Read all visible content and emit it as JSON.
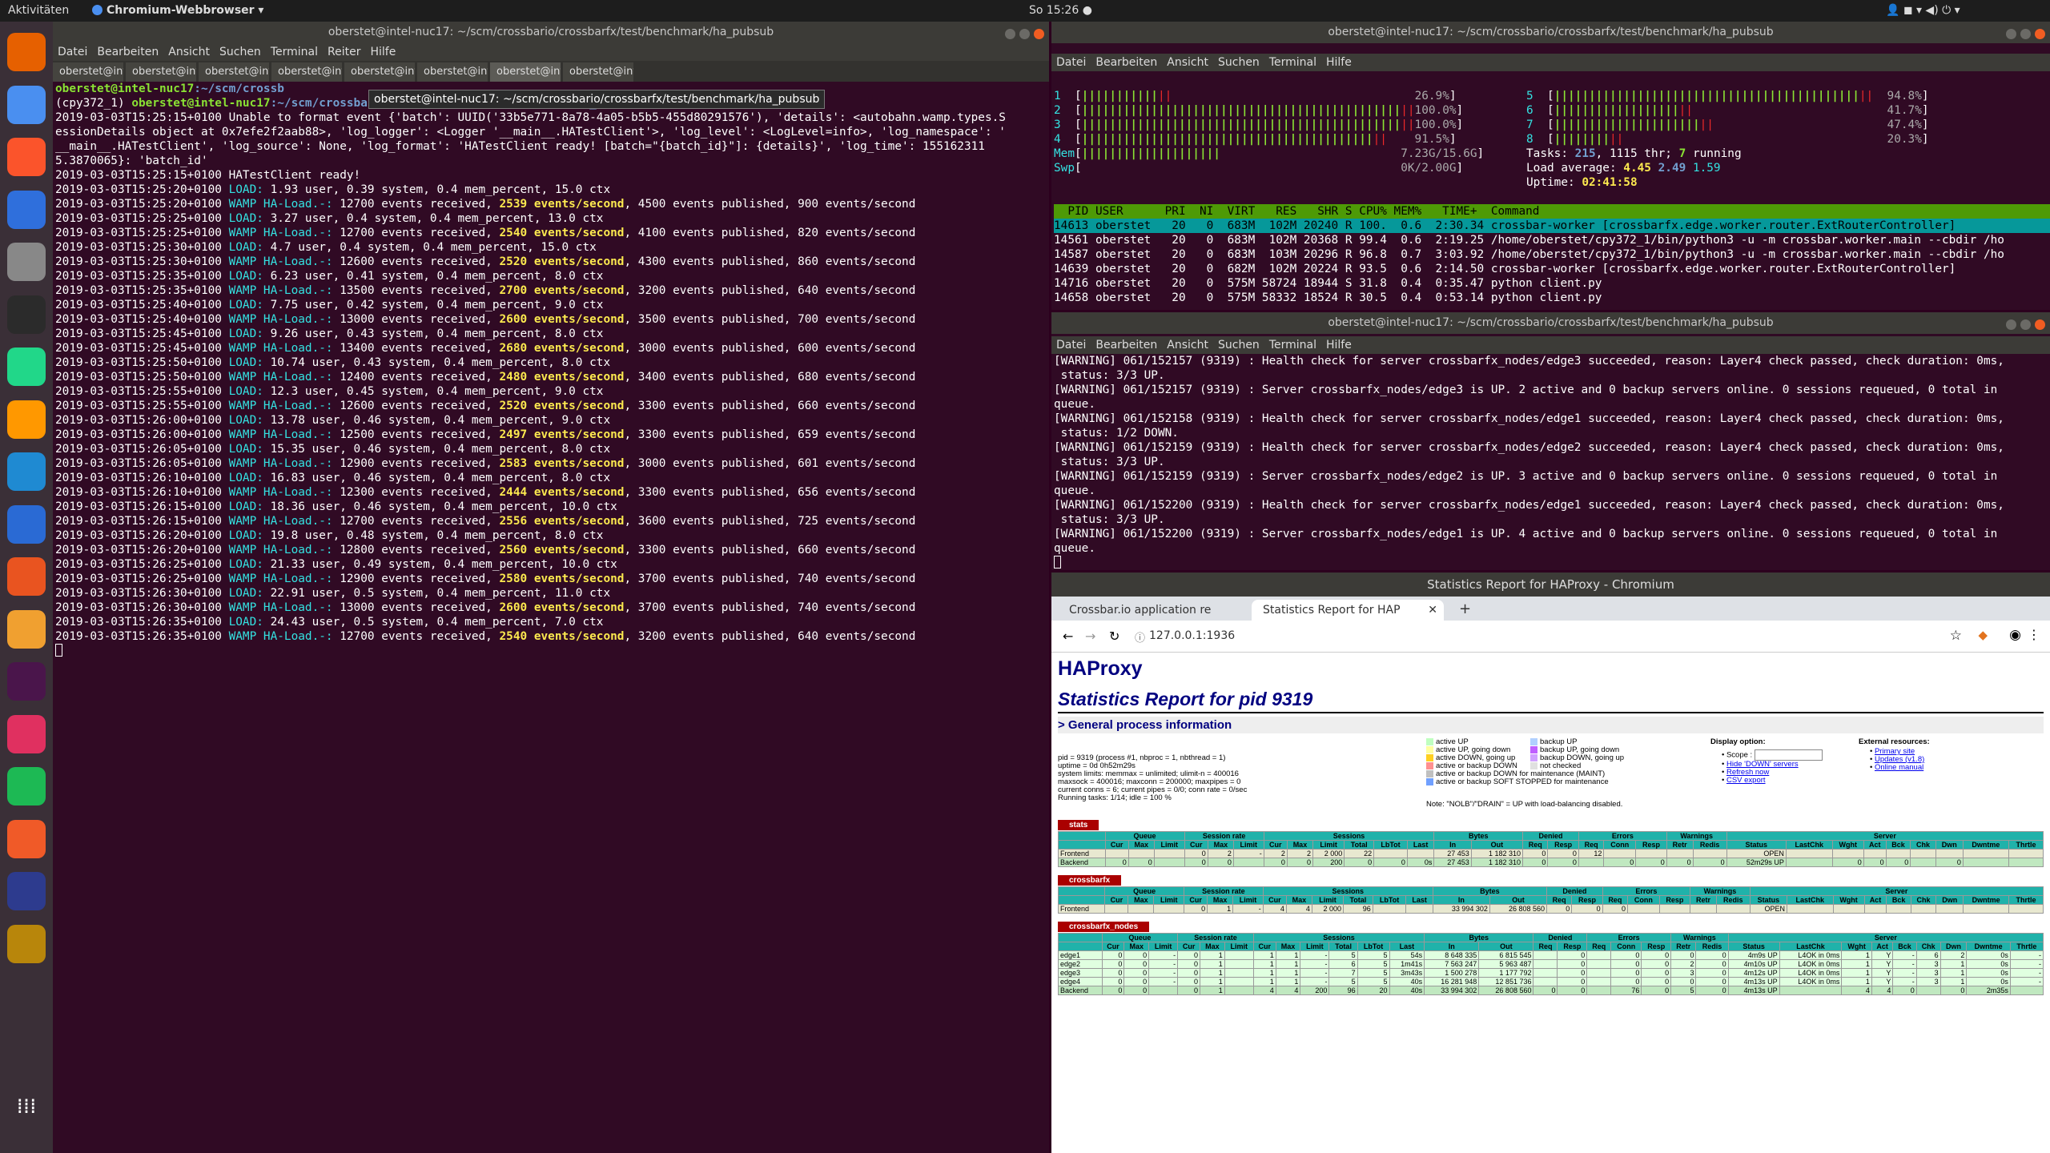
{
  "topbar": {
    "activities": "Aktivitäten",
    "app": "Chromium-Webbrowser ▾",
    "clock": "So 15:26 ●"
  },
  "dock": {
    "icons": [
      "firefox-icon",
      "chromium-icon",
      "brave-icon",
      "thunderbird-icon",
      "files-icon",
      "terminal-icon",
      "pycharm-icon",
      "sublime-icon",
      "vscode-icon",
      "writer-icon",
      "software-icon",
      "game-icon",
      "slack-icon",
      "mail-icon",
      "spotify-icon",
      "crossover-icon",
      "vlc-icon",
      "image-viewer-icon",
      "apps-grid-icon"
    ]
  },
  "left": {
    "title": "oberstet@intel-nuc17: ~/scm/crossbario/crossbarfx/test/benchmark/ha_pubsub",
    "menu": [
      "Datei",
      "Bearbeiten",
      "Ansicht",
      "Suchen",
      "Terminal",
      "Reiter",
      "Hilfe"
    ],
    "tabs": [
      "oberstet@int...",
      "oberstet@int...",
      "oberstet@int...",
      "oberstet@int...",
      "oberstet@int...",
      "oberstet@int...",
      "oberstet@int...",
      "oberstet@int..."
    ],
    "tooltip": "oberstet@intel-nuc17: ~/scm/crossbario/crossbarfx/test/benchmark/ha_pubsub",
    "prompt_user": "oberstet@intel-nuc17",
    "prompt_path1": ":~/scm/crossb",
    "prompt_path2": ":~/scm/crossbario/crossbarfx/test/benchmark/ha_pubsub",
    "cmd": "$ python client.py",
    "env": "(cpy372_1) ",
    "raw": [
      "essionDetails object at 0x7efe2f2aab88>, 'log_logger': <Logger '__main__.HATestClient'>, 'log_level': <LogLevel=info>, 'log_namespace': '",
      "__main__.HATestClient', 'log_source': None, 'log_format': 'HATestClient ready! [batch=\"{batch_id}\"]: {details}', 'log_time': 155162311",
      "5.3870065}: 'batch_id'",
      "2019-03-03T15:25:15+0100 HATestClient ready!"
    ],
    "unable": "2019-03-03T15:25:15+0100 Unable to format event {'batch': UUID('33b5e771-8a78-4a05-b5b5-455d80291576'), 'details': <autobahn.wamp.types.S",
    "logs": [
      {
        "ts": "2019-03-03T15:25:20+0100",
        "k": "L",
        "t": "1.93 user, 0.39 system, 0.4 mem_percent, 15.0 ctx"
      },
      {
        "ts": "2019-03-03T15:25:20+0100",
        "k": "W",
        "a": "12700 events received, ",
        "e": "2539 events/second",
        "c": ", 4500 events published, 900 events/second"
      },
      {
        "ts": "2019-03-03T15:25:25+0100",
        "k": "L",
        "t": "3.27 user, 0.4 system, 0.4 mem_percent, 13.0 ctx"
      },
      {
        "ts": "2019-03-03T15:25:25+0100",
        "k": "W",
        "a": "12700 events received, ",
        "e": "2540 events/second",
        "c": ", 4100 events published, 820 events/second"
      },
      {
        "ts": "2019-03-03T15:25:30+0100",
        "k": "L",
        "t": "4.7 user, 0.4 system, 0.4 mem_percent, 15.0 ctx"
      },
      {
        "ts": "2019-03-03T15:25:30+0100",
        "k": "W",
        "a": "12600 events received, ",
        "e": "2520 events/second",
        "c": ", 4300 events published, 860 events/second"
      },
      {
        "ts": "2019-03-03T15:25:35+0100",
        "k": "L",
        "t": "6.23 user, 0.41 system, 0.4 mem_percent, 8.0 ctx"
      },
      {
        "ts": "2019-03-03T15:25:35+0100",
        "k": "W",
        "a": "13500 events received, ",
        "e": "2700 events/second",
        "c": ", 3200 events published, 640 events/second"
      },
      {
        "ts": "2019-03-03T15:25:40+0100",
        "k": "L",
        "t": "7.75 user, 0.42 system, 0.4 mem_percent, 9.0 ctx"
      },
      {
        "ts": "2019-03-03T15:25:40+0100",
        "k": "W",
        "a": "13000 events received, ",
        "e": "2600 events/second",
        "c": ", 3500 events published, 700 events/second"
      },
      {
        "ts": "2019-03-03T15:25:45+0100",
        "k": "L",
        "t": "9.26 user, 0.43 system, 0.4 mem_percent, 8.0 ctx"
      },
      {
        "ts": "2019-03-03T15:25:45+0100",
        "k": "W",
        "a": "13400 events received, ",
        "e": "2680 events/second",
        "c": ", 3000 events published, 600 events/second"
      },
      {
        "ts": "2019-03-03T15:25:50+0100",
        "k": "L",
        "t": "10.74 user, 0.43 system, 0.4 mem_percent, 8.0 ctx"
      },
      {
        "ts": "2019-03-03T15:25:50+0100",
        "k": "W",
        "a": "12400 events received, ",
        "e": "2480 events/second",
        "c": ", 3400 events published, 680 events/second"
      },
      {
        "ts": "2019-03-03T15:25:55+0100",
        "k": "L",
        "t": "12.3 user, 0.45 system, 0.4 mem_percent, 9.0 ctx"
      },
      {
        "ts": "2019-03-03T15:25:55+0100",
        "k": "W",
        "a": "12600 events received, ",
        "e": "2520 events/second",
        "c": ", 3300 events published, 660 events/second"
      },
      {
        "ts": "2019-03-03T15:26:00+0100",
        "k": "L",
        "t": "13.78 user, 0.46 system, 0.4 mem_percent, 9.0 ctx"
      },
      {
        "ts": "2019-03-03T15:26:00+0100",
        "k": "W",
        "a": "12500 events received, ",
        "e": "2497 events/second",
        "c": ", 3300 events published, 659 events/second"
      },
      {
        "ts": "2019-03-03T15:26:05+0100",
        "k": "L",
        "t": "15.35 user, 0.46 system, 0.4 mem_percent, 8.0 ctx"
      },
      {
        "ts": "2019-03-03T15:26:05+0100",
        "k": "W",
        "a": "12900 events received, ",
        "e": "2583 events/second",
        "c": ", 3000 events published, 601 events/second"
      },
      {
        "ts": "2019-03-03T15:26:10+0100",
        "k": "L",
        "t": "16.83 user, 0.46 system, 0.4 mem_percent, 8.0 ctx"
      },
      {
        "ts": "2019-03-03T15:26:10+0100",
        "k": "W",
        "a": "12300 events received, ",
        "e": "2444 events/second",
        "c": ", 3300 events published, 656 events/second"
      },
      {
        "ts": "2019-03-03T15:26:15+0100",
        "k": "L",
        "t": "18.36 user, 0.46 system, 0.4 mem_percent, 10.0 ctx"
      },
      {
        "ts": "2019-03-03T15:26:15+0100",
        "k": "W",
        "a": "12700 events received, ",
        "e": "2556 events/second",
        "c": ", 3600 events published, 725 events/second"
      },
      {
        "ts": "2019-03-03T15:26:20+0100",
        "k": "L",
        "t": "19.8 user, 0.48 system, 0.4 mem_percent, 8.0 ctx"
      },
      {
        "ts": "2019-03-03T15:26:20+0100",
        "k": "W",
        "a": "12800 events received, ",
        "e": "2560 events/second",
        "c": ", 3300 events published, 660 events/second"
      },
      {
        "ts": "2019-03-03T15:26:25+0100",
        "k": "L",
        "t": "21.33 user, 0.49 system, 0.4 mem_percent, 10.0 ctx"
      },
      {
        "ts": "2019-03-03T15:26:25+0100",
        "k": "W",
        "a": "12900 events received, ",
        "e": "2580 events/second",
        "c": ", 3700 events published, 740 events/second"
      },
      {
        "ts": "2019-03-03T15:26:30+0100",
        "k": "L",
        "t": "22.91 user, 0.5 system, 0.4 mem_percent, 11.0 ctx"
      },
      {
        "ts": "2019-03-03T15:26:30+0100",
        "k": "W",
        "a": "13000 events received, ",
        "e": "2600 events/second",
        "c": ", 3700 events published, 740 events/second"
      },
      {
        "ts": "2019-03-03T15:26:35+0100",
        "k": "L",
        "t": "24.43 user, 0.5 system, 0.4 mem_percent, 7.0 ctx"
      },
      {
        "ts": "2019-03-03T15:26:35+0100",
        "k": "W",
        "a": "12700 events received, ",
        "e": "2540 events/second",
        "c": ", 3200 events published, 640 events/second"
      }
    ],
    "load_label": "LOAD: ",
    "wamp_label": "WAMP HA-Load.-: "
  },
  "htop": {
    "title": "oberstet@intel-nuc17: ~/scm/crossbario/crossbarfx/test/benchmark/ha_pubsub",
    "menu": [
      "Datei",
      "Bearbeiten",
      "Ansicht",
      "Suchen",
      "Terminal",
      "Hilfe"
    ],
    "cpus_left": [
      {
        "n": "1",
        "p": "26.9%",
        "f": 0.27
      },
      {
        "n": "2",
        "p": "100.0%",
        "f": 1.0
      },
      {
        "n": "3",
        "p": "100.0%",
        "f": 1.0
      },
      {
        "n": "4",
        "p": "91.5%",
        "f": 0.92
      }
    ],
    "cpus_right": [
      {
        "n": "5",
        "p": "94.8%",
        "f": 0.95
      },
      {
        "n": "6",
        "p": "41.7%",
        "f": 0.42
      },
      {
        "n": "7",
        "p": "47.4%",
        "f": 0.47
      },
      {
        "n": "8",
        "p": "20.3%",
        "f": 0.2
      }
    ],
    "mem": "7.23G/15.6G",
    "swp": "0K/2.00G",
    "tasks": "Tasks: ",
    "tasks_n": "215",
    "thr": ", 1115 thr; ",
    "run_n": "7",
    "running": " running",
    "load": "Load average: ",
    "load1": "4.45",
    "load5": " 2.49",
    "load15": " 1.59",
    "uptime": "Uptime: ",
    "uptime_v": "02:41:58",
    "header": "  PID USER      PRI  NI  VIRT   RES   SHR S CPU% MEM%   TIME+  Command",
    "procs": [
      "14613 oberstet   20   0  683M  102M 20240 R 100.  0.6  2:30.34 crossbar-worker [crossbarfx.edge.worker.router.ExtRouterController]",
      "14561 oberstet   20   0  683M  102M 20368 R 99.4  0.6  2:19.25 /home/oberstet/cpy372_1/bin/python3 -u -m crossbar.worker.main --cbdir /ho",
      "14587 oberstet   20   0  683M  103M 20296 R 96.8  0.7  3:03.92 /home/oberstet/cpy372_1/bin/python3 -u -m crossbar.worker.main --cbdir /ho",
      "14639 oberstet   20   0  682M  102M 20224 R 93.5  0.6  2:14.50 crossbar-worker [crossbarfx.edge.worker.router.ExtRouterController]",
      "14716 oberstet   20   0  575M 58724 18944 S 31.8  0.4  0:35.47 python client.py",
      "14658 oberstet   20   0  575M 58332 18524 R 30.5  0.4  0:53.14 python client.py"
    ]
  },
  "haproxy_log": {
    "title": "oberstet@intel-nuc17: ~/scm/crossbario/crossbarfx/test/benchmark/ha_pubsub",
    "menu": [
      "Datei",
      "Bearbeiten",
      "Ansicht",
      "Suchen",
      "Terminal",
      "Hilfe"
    ],
    "lines": [
      "[WARNING] 061/152157 (9319) : Health check for server crossbarfx_nodes/edge3 succeeded, reason: Layer4 check passed, check duration: 0ms,",
      " status: 3/3 UP.",
      "[WARNING] 061/152157 (9319) : Server crossbarfx_nodes/edge3 is UP. 2 active and 0 backup servers online. 0 sessions requeued, 0 total in",
      "queue.",
      "[WARNING] 061/152158 (9319) : Health check for server crossbarfx_nodes/edge1 succeeded, reason: Layer4 check passed, check duration: 0ms,",
      " status: 1/2 DOWN.",
      "[WARNING] 061/152159 (9319) : Health check for server crossbarfx_nodes/edge2 succeeded, reason: Layer4 check passed, check duration: 0ms,",
      " status: 3/3 UP.",
      "[WARNING] 061/152159 (9319) : Server crossbarfx_nodes/edge2 is UP. 3 active and 0 backup servers online. 0 sessions requeued, 0 total in",
      "queue.",
      "[WARNING] 061/152200 (9319) : Health check for server crossbarfx_nodes/edge1 succeeded, reason: Layer4 check passed, check duration: 0ms,",
      " status: 3/3 UP.",
      "[WARNING] 061/152200 (9319) : Server crossbarfx_nodes/edge1 is UP. 4 active and 0 backup servers online. 0 sessions requeued, 0 total in",
      "queue."
    ]
  },
  "chrome": {
    "title": "Statistics Report for HAProxy - Chromium",
    "tab1": "Crossbar.io application re",
    "tab2": "Statistics Report for HAP",
    "url": "127.0.0.1:1936",
    "h1": "HAProxy",
    "h2": "Statistics Report for pid 9319",
    "h3": "> General process information",
    "info": [
      "pid = 9319 (process #1, nbproc = 1, nbthread = 1)",
      "uptime = 0d 0h52m29s",
      "system limits: memmax = unlimited; ulimit-n = 400016",
      "maxsock = 400016; maxconn = 200000; maxpipes = 0",
      "current conns = 6; current pipes = 0/0; conn rate = 0/sec",
      "Running tasks: 1/14; idle = 100 %"
    ],
    "legend": [
      {
        "c": "#c0ffc0",
        "t": "active UP"
      },
      {
        "c": "#ffffa0",
        "t": "active UP, going down"
      },
      {
        "c": "#ffd020",
        "t": "active DOWN, going up"
      },
      {
        "c": "#ff9090",
        "t": "active or backup DOWN"
      },
      {
        "c": "#c0c0c0",
        "t": "active or backup DOWN for maintenance (MAINT)"
      },
      {
        "c": "#70a0ff",
        "t": "active or backup SOFT STOPPED for maintenance"
      }
    ],
    "legend2": [
      {
        "c": "#b0d0ff",
        "t": "backup UP"
      },
      {
        "c": "#c060ff",
        "t": "backup UP, going down"
      },
      {
        "c": "#d0a0ff",
        "t": "backup DOWN, going up"
      },
      {
        "c": "#e0e0e0",
        "t": "not checked"
      }
    ],
    "note": "Note: \"NOLB\"/\"DRAIN\" = UP with load-balancing disabled.",
    "display": "Display option:",
    "scope": "Scope :",
    "disp_links": [
      "Hide 'DOWN' servers",
      "Refresh now",
      "CSV export"
    ],
    "ext": "External resources:",
    "ext_links": [
      "Primary site",
      "Updates (v1.8)",
      "Online manual"
    ],
    "groups": [
      "Queue",
      "Session rate",
      "Sessions",
      "Bytes",
      "Denied",
      "Errors",
      "Warnings",
      "Server"
    ],
    "cols": [
      "",
      "Cur",
      "Max",
      "Limit",
      "Cur",
      "Max",
      "Limit",
      "Cur",
      "Max",
      "Limit",
      "Total",
      "LbTot",
      "Last",
      "In",
      "Out",
      "Req",
      "Resp",
      "Req",
      "Conn",
      "Resp",
      "Retr",
      "Redis",
      "Status",
      "LastChk",
      "Wght",
      "Act",
      "Bck",
      "Chk",
      "Dwn",
      "Dwntme",
      "Thrtle"
    ],
    "stats_name": "stats",
    "stats_rows": [
      {
        "c": "fe",
        "v": [
          "Frontend",
          "",
          "",
          "",
          "0",
          "2",
          "-",
          "2",
          "2",
          "2 000",
          "22",
          "",
          "",
          "27 453",
          "1 182 310",
          "0",
          "0",
          "12",
          "",
          "",
          "",
          "",
          "OPEN",
          "",
          "",
          "",
          "",
          "",
          "",
          "",
          ""
        ]
      },
      {
        "c": "be",
        "v": [
          "Backend",
          "0",
          "0",
          "",
          "0",
          "0",
          "",
          "0",
          "0",
          "200",
          "0",
          "0",
          "0s",
          "27 453",
          "1 182 310",
          "0",
          "0",
          "",
          "0",
          "0",
          "0",
          "0",
          "52m29s UP",
          "",
          "0",
          "0",
          "0",
          "",
          "0",
          "",
          ""
        ]
      }
    ],
    "cbfx_name": "crossbarfx",
    "cbfx_rows": [
      {
        "c": "fe",
        "v": [
          "Frontend",
          "",
          "",
          "",
          "0",
          "1",
          "-",
          "4",
          "4",
          "2 000",
          "96",
          "",
          "",
          "33 994 302",
          "26 808 560",
          "0",
          "0",
          "0",
          "",
          "",
          "",
          "",
          "OPEN",
          "",
          "",
          "",
          "",
          "",
          "",
          "",
          ""
        ]
      }
    ],
    "nodes_name": "crossbarfx_nodes",
    "nodes_rows": [
      {
        "c": "",
        "v": [
          "edge1",
          "0",
          "0",
          "-",
          "0",
          "1",
          "",
          "1",
          "1",
          "-",
          "5",
          "5",
          "54s",
          "8 648 335",
          "6 815 545",
          "",
          "0",
          "",
          "0",
          "0",
          "0",
          "0",
          "4m9s UP",
          "L4OK in 0ms",
          "1",
          "Y",
          "-",
          "6",
          "2",
          "0s",
          "-"
        ]
      },
      {
        "c": "",
        "v": [
          "edge2",
          "0",
          "0",
          "-",
          "0",
          "1",
          "",
          "1",
          "1",
          "-",
          "6",
          "5",
          "1m41s",
          "7 563 247",
          "5 963 487",
          "",
          "0",
          "",
          "0",
          "0",
          "2",
          "0",
          "4m10s UP",
          "L4OK in 0ms",
          "1",
          "Y",
          "-",
          "3",
          "1",
          "0s",
          "-"
        ]
      },
      {
        "c": "",
        "v": [
          "edge3",
          "0",
          "0",
          "-",
          "0",
          "1",
          "",
          "1",
          "1",
          "-",
          "7",
          "5",
          "3m43s",
          "1 500 278",
          "1 177 792",
          "",
          "0",
          "",
          "0",
          "0",
          "3",
          "0",
          "4m12s UP",
          "L4OK in 0ms",
          "1",
          "Y",
          "-",
          "3",
          "1",
          "0s",
          "-"
        ]
      },
      {
        "c": "",
        "v": [
          "edge4",
          "0",
          "0",
          "-",
          "0",
          "1",
          "",
          "1",
          "1",
          "-",
          "5",
          "5",
          "40s",
          "16 281 948",
          "12 851 736",
          "",
          "0",
          "",
          "0",
          "0",
          "0",
          "0",
          "4m13s UP",
          "L4OK in 0ms",
          "1",
          "Y",
          "-",
          "3",
          "1",
          "0s",
          "-"
        ]
      },
      {
        "c": "be",
        "v": [
          "Backend",
          "0",
          "0",
          "",
          "0",
          "1",
          "",
          "4",
          "4",
          "200",
          "96",
          "20",
          "40s",
          "33 994 302",
          "26 808 560",
          "0",
          "0",
          "",
          "76",
          "0",
          "5",
          "0",
          "4m13s UP",
          "",
          "4",
          "4",
          "0",
          "",
          "0",
          "2m35s",
          ""
        ]
      }
    ]
  }
}
